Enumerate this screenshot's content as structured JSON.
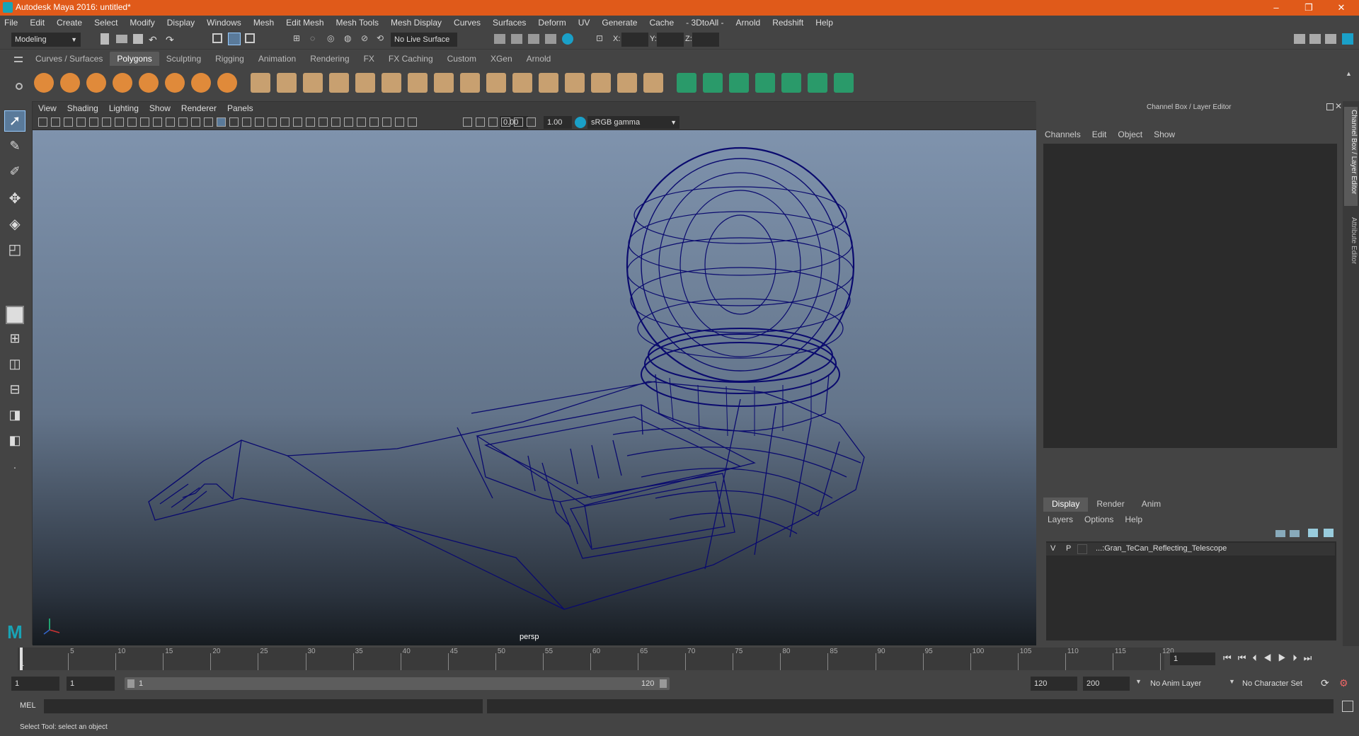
{
  "window": {
    "title": "Autodesk Maya 2016: untitled*",
    "minimize": "–",
    "maximize": "❐",
    "close": "✕"
  },
  "menubar": [
    "File",
    "Edit",
    "Create",
    "Select",
    "Modify",
    "Display",
    "Windows",
    "Mesh",
    "Edit Mesh",
    "Mesh Tools",
    "Mesh Display",
    "Curves",
    "Surfaces",
    "Deform",
    "UV",
    "Generate",
    "Cache",
    "- 3DtoAll -",
    "Arnold",
    "Redshift",
    "Help"
  ],
  "status": {
    "menuset": "Modeling",
    "live_surface": "No Live Surface",
    "x_label": "X:",
    "y_label": "Y:",
    "z_label": "Z:"
  },
  "shelf_tabs": [
    "Curves / Surfaces",
    "Polygons",
    "Sculpting",
    "Rigging",
    "Animation",
    "Rendering",
    "FX",
    "FX Caching",
    "Custom",
    "XGen",
    "Arnold"
  ],
  "shelf_active": "Polygons",
  "viewport": {
    "menus": [
      "View",
      "Shading",
      "Lighting",
      "Show",
      "Renderer",
      "Panels"
    ],
    "exposure": "0.00",
    "gamma": "1.00",
    "colorspace": "sRGB gamma",
    "camera_label": "persp"
  },
  "channel_box": {
    "header": "Channel Box / Layer Editor",
    "menus": [
      "Channels",
      "Edit",
      "Object",
      "Show"
    ],
    "layer_tabs": [
      "Display",
      "Render",
      "Anim"
    ],
    "layer_menus": [
      "Layers",
      "Options",
      "Help"
    ],
    "layer": {
      "v": "V",
      "p": "P",
      "name": "...:Gran_TeCan_Reflecting_Telescope"
    },
    "side_tab_1": "Channel Box / Layer Editor",
    "side_tab_2": "Attribute Editor"
  },
  "timeline": {
    "ticks": [
      "5",
      "10",
      "15",
      "20",
      "25",
      "30",
      "35",
      "40",
      "45",
      "50",
      "55",
      "60",
      "65",
      "70",
      "75",
      "80",
      "85",
      "90",
      "95",
      "100",
      "105",
      "110",
      "115",
      "120"
    ],
    "start_marker": "1",
    "current_frame": "1"
  },
  "range": {
    "start": "1",
    "anim_start": "1",
    "slider_start": "1",
    "slider_end": "120",
    "anim_end": "120",
    "end": "200",
    "anim_layer": "No Anim Layer",
    "char_set": "No Character Set"
  },
  "command": {
    "mode": "MEL"
  },
  "help_text": "Select Tool: select an object",
  "colors": {
    "titlebar": "#e05a1a",
    "wire": "#0a0a6e",
    "accent": "#1aa0c8"
  }
}
